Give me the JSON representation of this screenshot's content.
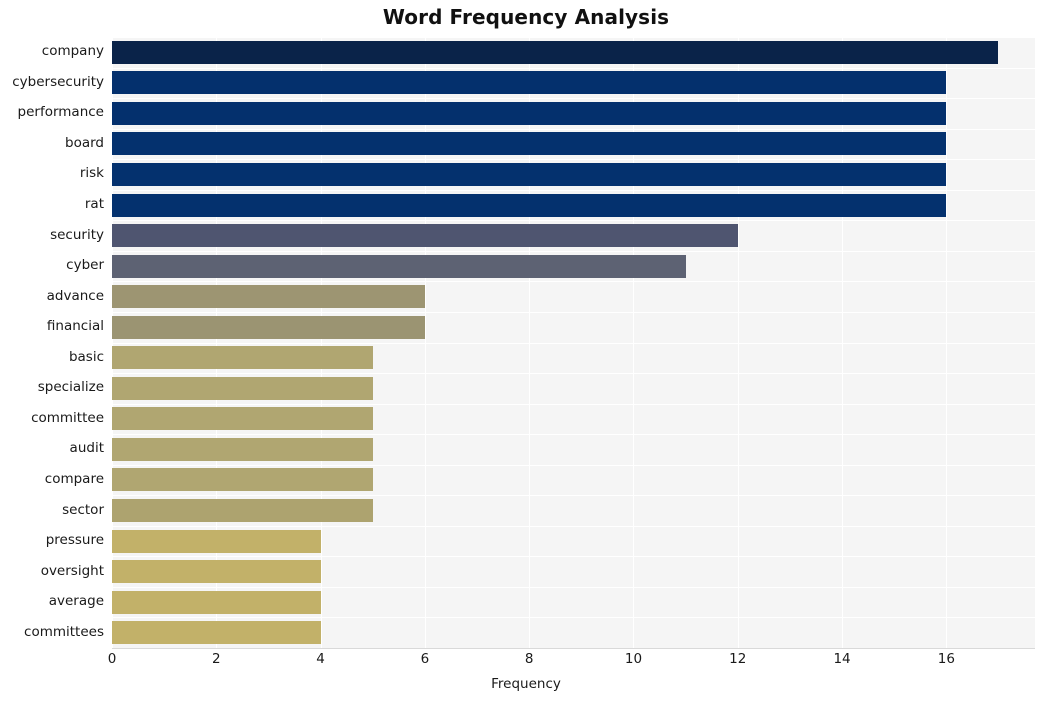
{
  "chart_data": {
    "type": "bar",
    "orientation": "horizontal",
    "title": "Word Frequency Analysis",
    "xlabel": "Frequency",
    "ylabel": "",
    "categories": [
      "company",
      "cybersecurity",
      "performance",
      "board",
      "risk",
      "rat",
      "security",
      "cyber",
      "advance",
      "financial",
      "basic",
      "specialize",
      "committee",
      "audit",
      "compare",
      "sector",
      "pressure",
      "oversight",
      "average",
      "committees"
    ],
    "values": [
      17,
      16,
      16,
      16,
      16,
      16,
      12,
      11,
      6,
      6,
      5,
      5,
      5,
      5,
      5,
      5,
      4,
      4,
      4,
      4
    ],
    "bar_colors": [
      "#0a2349",
      "#04306d",
      "#04306d",
      "#04316e",
      "#04316e",
      "#04316e",
      "#4f5570",
      "#5d6273",
      "#9d9572",
      "#9b9472",
      "#b0a671",
      "#b0a671",
      "#b0a671",
      "#b0a671",
      "#b0a671",
      "#ada36f",
      "#c2b169",
      "#c2b169",
      "#c2b169",
      "#c2b169"
    ],
    "xticks": [
      0,
      2,
      4,
      6,
      8,
      10,
      12,
      14,
      16
    ],
    "xlim": [
      0,
      17.7
    ],
    "grid": true,
    "grid_color": "#ffffff",
    "plot_background": "#f5f5f5",
    "figure_background": "#ffffff",
    "legend": null
  }
}
